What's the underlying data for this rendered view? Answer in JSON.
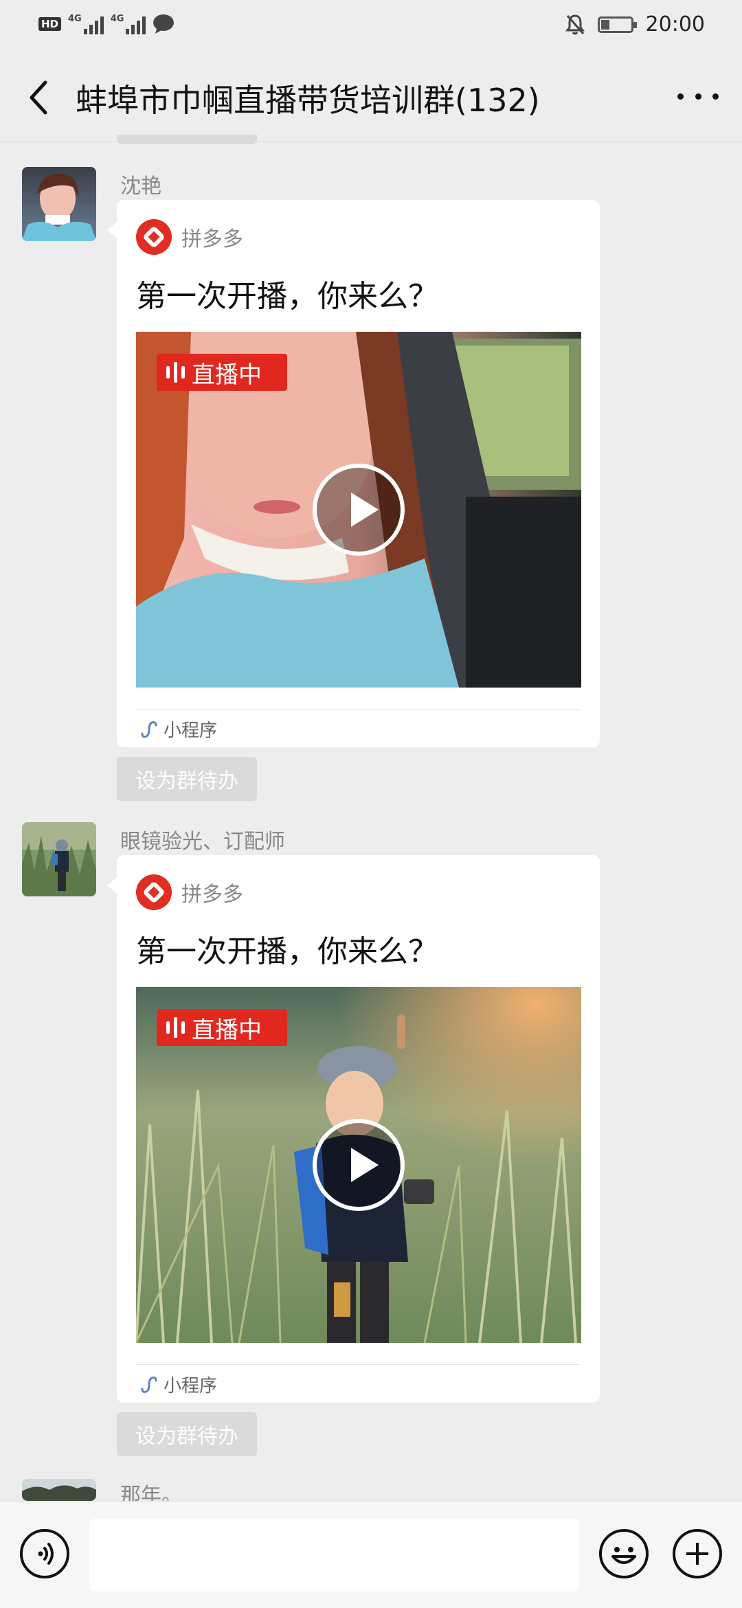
{
  "status_bar": {
    "hd_badge": "HD",
    "network_1": "4G",
    "network_2": "4G",
    "time": "20:00",
    "battery_level": 0.3
  },
  "header": {
    "title": "蚌埠市巾帼直播带货培训群(132)",
    "back_icon": "chevron-left-icon",
    "more_icon": "more-dots-icon"
  },
  "messages": [
    {
      "sender": "沈艳",
      "app_name": "拼多多",
      "title": "第一次开播，你来么？",
      "live_label": "直播中",
      "mini_program_label": "小程序",
      "todo_label": "设为群待办"
    },
    {
      "sender": "眼镜验光、订配师",
      "app_name": "拼多多",
      "title": "第一次开播，你来么？",
      "live_label": "直播中",
      "mini_program_label": "小程序",
      "todo_label": "设为群待办"
    },
    {
      "sender": "那年。"
    }
  ],
  "bottom_bar": {
    "voice_icon": "voice-icon",
    "emoji_icon": "emoji-icon",
    "plus_icon": "plus-icon"
  },
  "colors": {
    "background": "#ededed",
    "live_badge": "#e0281f",
    "pdd_brand": "#e02e24"
  }
}
